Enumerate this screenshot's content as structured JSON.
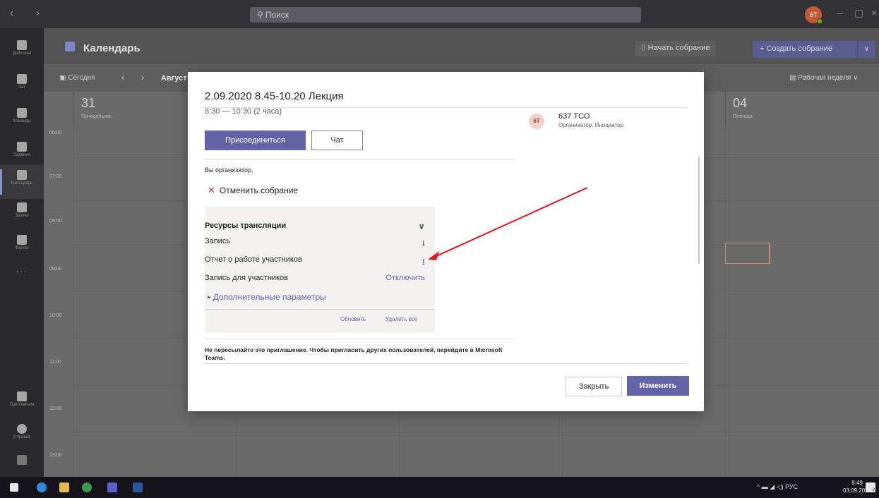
{
  "titlebar": {
    "search_placeholder": "Поиск",
    "avatar_initials": "6T"
  },
  "rail": {
    "items": [
      {
        "label": "Действия"
      },
      {
        "label": "Чат"
      },
      {
        "label": "Команды"
      },
      {
        "label": "Задания"
      },
      {
        "label": "Календарь"
      },
      {
        "label": "Звонки"
      },
      {
        "label": "Файлы"
      }
    ],
    "more": "...",
    "apps": "Приложения",
    "help": "Справка"
  },
  "calendar": {
    "title": "Календарь",
    "start_meeting": "Начать собрание",
    "create_meeting": "Создать собрание",
    "today": "Сегодня",
    "month": "Август",
    "view": "Рабочая неделя",
    "days": [
      {
        "num": "31",
        "name": "Понедельник"
      },
      {
        "num": "04",
        "name": "Пятница"
      }
    ],
    "hours": [
      "06:00",
      "07:00",
      "08:00",
      "09:00",
      "10:00",
      "11:00",
      "12:00",
      "13:00"
    ]
  },
  "modal": {
    "title": "2.09.2020 8.45-10.20 Лекция",
    "time": "8:30 — 10:30 (2 часа)",
    "join_button": "Присоединиться",
    "chat_button": "Чат",
    "organizer_note": "Вы организатор.",
    "cancel_meeting": "Отменить собрание",
    "resources": {
      "title": "Ресурсы трансляции",
      "recording": "Запись",
      "attendee_report": "Отчет о работе участников",
      "attendee_recording": "Запись для участников",
      "disable": "Отключить",
      "advanced": "Дополнительные параметры",
      "refresh": "Обновить",
      "delete_all": "Удалить все"
    },
    "notice": "Не пересылайте это приглашение. Чтобы пригласить других пользователей, перейдите в Microsoft Teams.",
    "organizer": {
      "initials": "6T",
      "name": "637 ТСО",
      "role": "Организатор, Инициатор"
    },
    "close_button": "Закрыть",
    "edit_button": "Изменить"
  },
  "taskbar": {
    "lang": "РУС",
    "time": "8:49",
    "date": "03.09.2020",
    "notif_count": "2"
  },
  "colors": {
    "accent": "#6264a7",
    "arrow": "#e8141c",
    "cancel_x": "#c4314b"
  }
}
